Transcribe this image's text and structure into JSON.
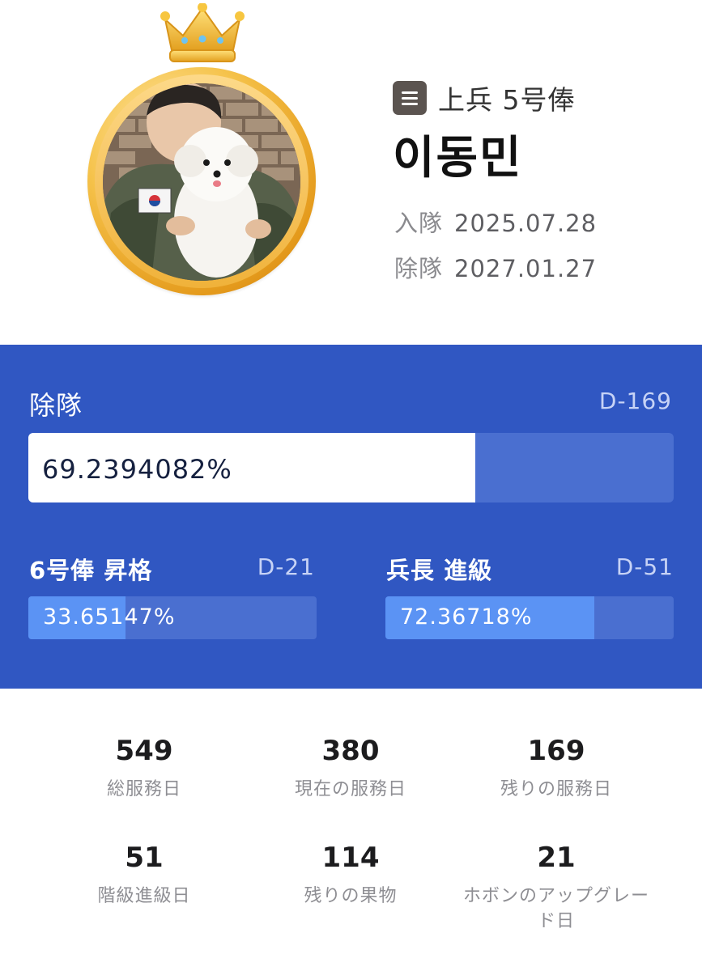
{
  "profile": {
    "rank": "上兵 5号俸",
    "name": "이동민",
    "enlist_label": "入隊",
    "enlist_date": "2025.07.28",
    "discharge_label": "除隊",
    "discharge_date": "2027.01.27",
    "avatar_icon": "crown-icon",
    "menu_icon": "menu-icon"
  },
  "progress": {
    "main": {
      "label": "除隊",
      "dday": "D-169",
      "percent_text": "69.2394082%",
      "fraction": 0.692394082
    },
    "next_pay": {
      "label": "6号俸 昇格",
      "dday": "D-21",
      "percent_text": "33.65147%",
      "fraction": 0.3365147
    },
    "next_rank": {
      "label": "兵長 進級",
      "dday": "D-51",
      "percent_text": "72.36718%",
      "fraction": 0.7236718
    }
  },
  "stats": [
    {
      "value": "549",
      "label": "総服務日"
    },
    {
      "value": "380",
      "label": "現在の服務日"
    },
    {
      "value": "169",
      "label": "残りの服務日"
    },
    {
      "value": "51",
      "label": "階級進級日"
    },
    {
      "value": "114",
      "label": "残りの果物"
    },
    {
      "value": "21",
      "label": "ホボンのアップグレード日"
    }
  ],
  "colors": {
    "panel_blue": "#3057c2",
    "track_blue": "#4a6fd0",
    "fill_light_blue": "#5b93f4",
    "gold": "#f0b23a"
  }
}
